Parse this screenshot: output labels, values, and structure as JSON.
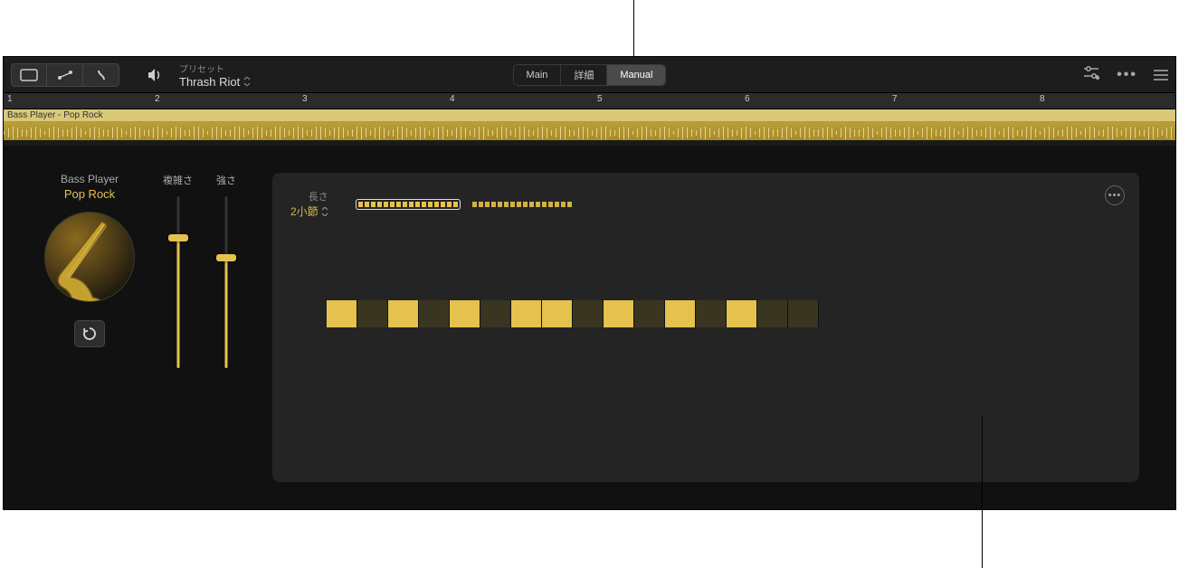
{
  "toolbar": {
    "preset_label": "プリセット",
    "preset_name": "Thrash Riot"
  },
  "tabs": [
    {
      "label": "Main",
      "active": false
    },
    {
      "label": "詳細",
      "active": false
    },
    {
      "label": "Manual",
      "active": true
    }
  ],
  "ruler": [
    "1",
    "2",
    "3",
    "4",
    "5",
    "6",
    "7",
    "8"
  ],
  "region": {
    "name": "Bass Player - Pop Rock"
  },
  "player": {
    "type_label": "Bass Player",
    "style_label": "Pop Rock"
  },
  "sliders": {
    "complexity": {
      "label": "複雑さ",
      "value": 0.76
    },
    "intensity": {
      "label": "強さ",
      "value": 0.64
    }
  },
  "pattern": {
    "length_label": "長さ",
    "length_value": "2小節",
    "segment_groups": [
      {
        "count": 16,
        "active": true
      },
      {
        "count": 16,
        "active": false
      }
    ],
    "steps": [
      1,
      0,
      1,
      0,
      1,
      0,
      1,
      1,
      0,
      1,
      0,
      1,
      0,
      1,
      0,
      0
    ]
  },
  "icons": {
    "region": "region-icon",
    "automation": "automation-icon",
    "flex": "flex-icon",
    "volume": "volume-icon",
    "sliders": "sliders-icon",
    "more_h": "more-horizontal-icon",
    "menu": "menu-icon",
    "reload": "reload-icon",
    "chevrons": "chevrons-icon"
  }
}
